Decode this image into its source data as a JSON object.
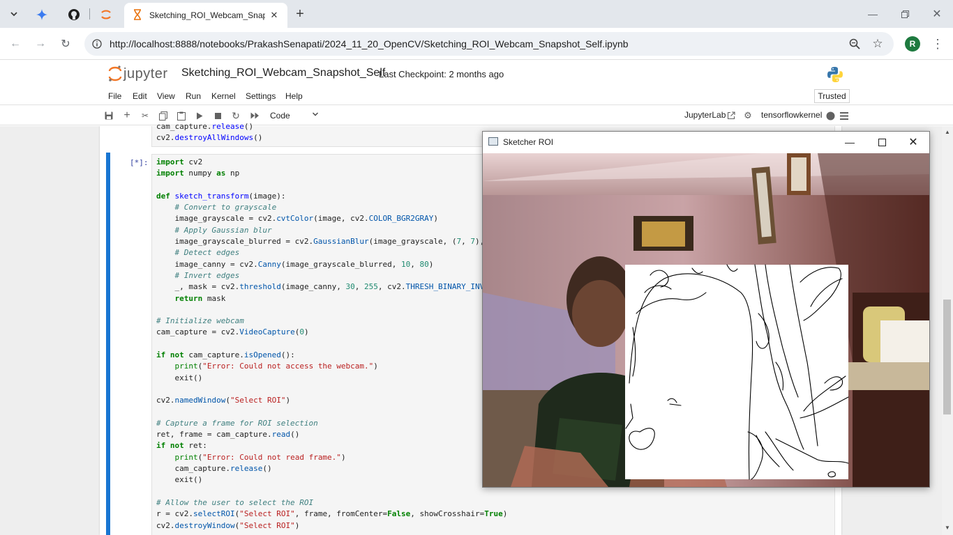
{
  "browser": {
    "tab_title": "Sketching_ROI_Webcam_Snapshot_Self",
    "url": "http://localhost:8888/notebooks/PrakashSenapati/2024_11_20_OpenCV/Sketching_ROI_Webcam_Snapshot_Self.ipynb",
    "profile_initial": "R"
  },
  "jupyter": {
    "logo_text": "jupyter",
    "notebook_title": "Sketching_ROI_Webcam_Snapshot_Self",
    "checkpoint": "Last Checkpoint: 2 months ago",
    "menu": [
      "File",
      "Edit",
      "View",
      "Run",
      "Kernel",
      "Settings",
      "Help"
    ],
    "trusted": "Trusted",
    "cell_type": "Code",
    "jupyterlab_link": "JupyterLab",
    "kernel_name": "tensorflowkernel"
  },
  "prev_cell": {
    "lines": [
      "cam_capture.release()",
      "cv2.destroyAllWindows()"
    ]
  },
  "active_cell": {
    "prompt": "[*]:"
  },
  "cv_window": {
    "title": "Sketcher ROI"
  },
  "colors": {
    "accent": "#1976d2",
    "keyword": "#008000",
    "comment": "#408080",
    "string": "#ba2121",
    "function": "#0000ff"
  },
  "icons": [
    "tab-search-icon",
    "gemini-icon",
    "github-icon",
    "jupyter-tab-icon",
    "hourglass-icon",
    "close-icon",
    "new-tab-icon",
    "back-icon",
    "forward-icon",
    "reload-icon",
    "site-info-icon",
    "zoom-icon",
    "bookmark-star-icon",
    "kebab-menu-icon",
    "save-icon",
    "add-cell-icon",
    "cut-icon",
    "copy-icon",
    "paste-icon",
    "run-icon",
    "stop-icon",
    "restart-icon",
    "fast-forward-icon",
    "external-link-icon",
    "settings-gear-icon",
    "kernel-status-icon",
    "hamburger-icon"
  ]
}
